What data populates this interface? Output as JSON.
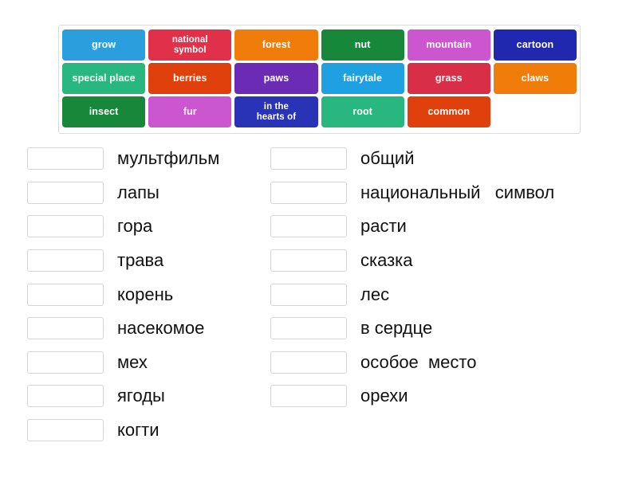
{
  "tile_bank": {
    "rows": [
      [
        {
          "label": "grow",
          "color": "#2b9fdd",
          "multiline": false
        },
        {
          "label": "national\nsymbol",
          "color": "#e0304a",
          "multiline": true
        },
        {
          "label": "forest",
          "color": "#f07d0a",
          "multiline": false
        },
        {
          "label": "nut",
          "color": "#17883a",
          "multiline": false
        },
        {
          "label": "mountain",
          "color": "#cb56cf",
          "multiline": false
        },
        {
          "label": "cartoon",
          "color": "#2128b0",
          "multiline": false
        }
      ],
      [
        {
          "label": "special place",
          "color": "#28b77f",
          "multiline": false
        },
        {
          "label": "berries",
          "color": "#e0400c",
          "multiline": false
        },
        {
          "label": "paws",
          "color": "#6b2bb5",
          "multiline": false
        },
        {
          "label": "fairytale",
          "color": "#1fa0e0",
          "multiline": false
        },
        {
          "label": "grass",
          "color": "#d92e48",
          "multiline": false
        },
        {
          "label": "claws",
          "color": "#f07d0a",
          "multiline": false
        }
      ],
      [
        {
          "label": "insect",
          "color": "#17883a",
          "multiline": false
        },
        {
          "label": "fur",
          "color": "#cb56cf",
          "multiline": false
        },
        {
          "label": "in the\nhearts of",
          "color": "#2834b5",
          "multiline": true
        },
        {
          "label": "root",
          "color": "#28b77f",
          "multiline": false
        },
        {
          "label": "common",
          "color": "#e0400c",
          "multiline": false
        },
        {
          "label": "",
          "color": "transparent",
          "multiline": false
        }
      ]
    ]
  },
  "answers": {
    "left_column": [
      {
        "label": "мультфильм"
      },
      {
        "label": "лапы"
      },
      {
        "label": "гора"
      },
      {
        "label": "трава"
      },
      {
        "label": "корень"
      },
      {
        "label": "насекомое"
      },
      {
        "label": "мех"
      },
      {
        "label": "ягоды"
      },
      {
        "label": "когти"
      }
    ],
    "right_column": [
      {
        "label": "общий"
      },
      {
        "label": "национальный   символ"
      },
      {
        "label": "расти"
      },
      {
        "label": "сказка"
      },
      {
        "label": "лес"
      },
      {
        "label": "в сердце"
      },
      {
        "label": "особое  место"
      },
      {
        "label": "орехи"
      }
    ]
  }
}
